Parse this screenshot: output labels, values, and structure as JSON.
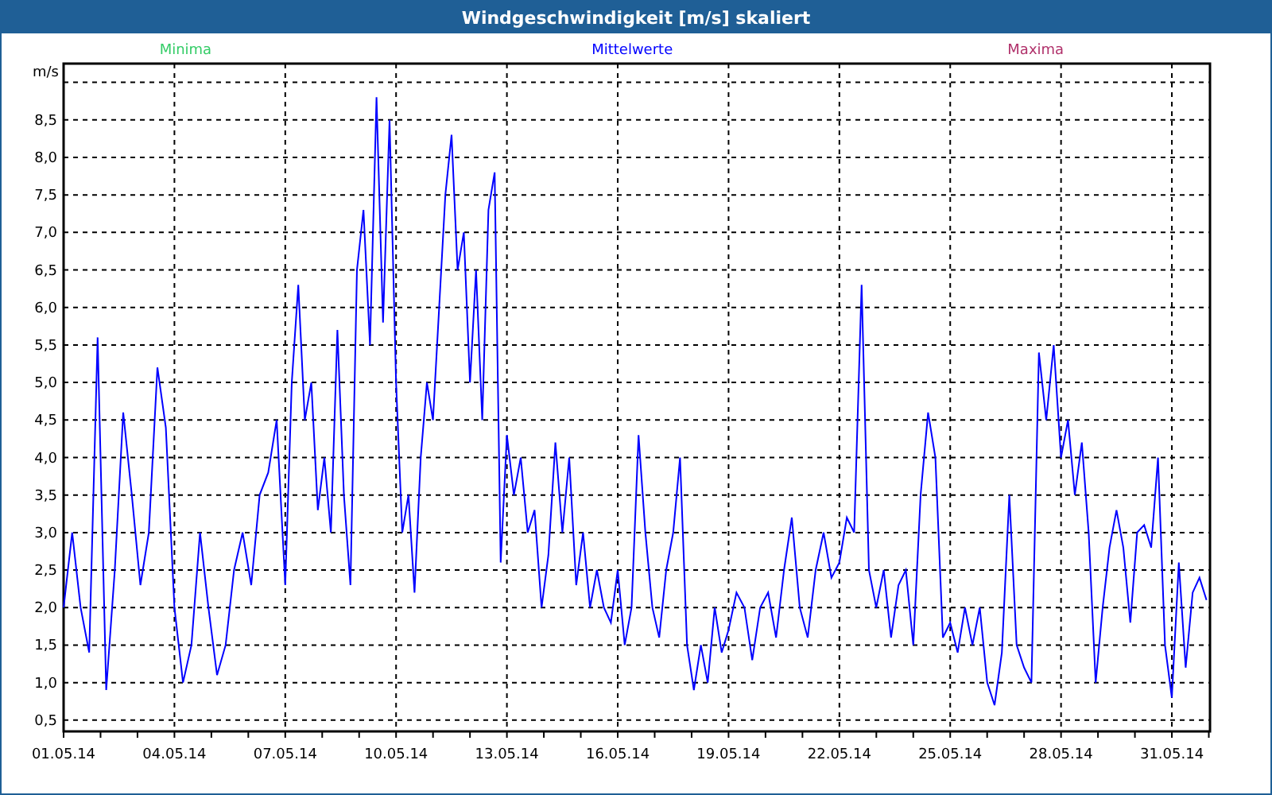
{
  "window": {
    "title": "Windgeschwindigkeit [m/s] skaliert"
  },
  "legend": [
    {
      "label": "Minima",
      "color": "#33cc66"
    },
    {
      "label": "Maxima",
      "color": "#b0306a"
    }
  ],
  "chart": {
    "chart_data": {
      "type": "line",
      "grid": true,
      "ylabel": "m/s",
      "ylim": [
        0.35,
        9.25
      ],
      "yticks": [
        {
          "value": 0.5,
          "label": "0,5"
        },
        {
          "value": 1,
          "label": "1,0"
        },
        {
          "value": 1.5,
          "label": "1,5"
        },
        {
          "value": 2,
          "label": "2,0"
        },
        {
          "value": 2.5,
          "label": "2,5"
        },
        {
          "value": 3,
          "label": "3,0"
        },
        {
          "value": 3.5,
          "label": "3,5"
        },
        {
          "value": 4,
          "label": "4,0"
        },
        {
          "value": 4.5,
          "label": "4,5"
        },
        {
          "value": 5,
          "label": "5,0"
        },
        {
          "value": 5.5,
          "label": "5,5"
        },
        {
          "value": 6,
          "label": "6,0"
        },
        {
          "value": 6.5,
          "label": "6,5"
        },
        {
          "value": 7,
          "label": "7,0"
        },
        {
          "value": 7.5,
          "label": "7,5"
        },
        {
          "value": 8,
          "label": "8,0"
        },
        {
          "value": 8.5,
          "label": "8,5"
        }
      ],
      "categories": [
        "01.05.14",
        null,
        null,
        null,
        null,
        null,
        null,
        null,
        null,
        null,
        null,
        null,
        null,
        "04.05.14",
        null,
        null,
        null,
        null,
        null,
        null,
        null,
        null,
        null,
        null,
        null,
        null,
        "07.05.14",
        null,
        null,
        null,
        null,
        null,
        null,
        null,
        null,
        null,
        null,
        null,
        null,
        null,
        null,
        null,
        null,
        "10.05.14",
        null,
        null,
        null,
        null,
        null,
        null,
        null,
        null,
        null,
        null,
        null,
        null,
        null,
        null,
        null,
        null,
        null,
        "13.05.14",
        null,
        null,
        null,
        null,
        null,
        null,
        null,
        null,
        null,
        null,
        null,
        null,
        null,
        null,
        null,
        "16.05.14",
        null,
        null,
        null,
        null,
        null,
        null,
        null,
        null,
        null,
        null,
        null,
        null,
        null,
        null,
        null,
        "19.05.14",
        null,
        null,
        null,
        null,
        null,
        null,
        null,
        null,
        null,
        null,
        null,
        null,
        null,
        "22.05.14",
        null,
        null,
        null,
        null,
        null,
        null,
        null,
        null,
        null,
        null,
        null,
        null,
        null,
        null,
        "25.05.14",
        null,
        null,
        null,
        null,
        null,
        null,
        null,
        null,
        null,
        null,
        null,
        null,
        null,
        null,
        "28.05.14",
        null,
        null,
        null,
        null,
        null,
        null,
        null,
        null,
        null,
        null,
        null,
        null,
        null,
        null,
        null,
        "31.05.14",
        null,
        null,
        null,
        null,
        null
      ],
      "series": [
        {
          "name": "Mittelwerte",
          "color": "#0000ff",
          "values": [
            2.0,
            3.0,
            2.0,
            1.4,
            5.6,
            0.9,
            2.5,
            4.6,
            3.5,
            2.3,
            3.0,
            5.2,
            4.4,
            2.0,
            1.0,
            1.5,
            3.0,
            2.0,
            1.1,
            1.5,
            2.5,
            3.0,
            2.3,
            3.5,
            3.8,
            4.5,
            2.3,
            5.0,
            6.3,
            4.5,
            5.0,
            3.3,
            4.0,
            3.0,
            5.7,
            3.5,
            2.3,
            6.5,
            7.3,
            5.5,
            8.8,
            5.8,
            8.5,
            5.0,
            3.0,
            3.5,
            2.2,
            4.0,
            5.0,
            4.5,
            6.0,
            7.5,
            8.3,
            6.5,
            7.0,
            5.0,
            6.5,
            4.5,
            7.3,
            7.8,
            2.6,
            4.3,
            3.5,
            4.0,
            3.0,
            3.3,
            2.0,
            2.7,
            4.2,
            3.0,
            4.0,
            2.3,
            3.0,
            2.0,
            2.5,
            2.0,
            1.8,
            2.5,
            1.5,
            2.0,
            4.3,
            3.0,
            2.0,
            1.6,
            2.5,
            3.0,
            4.0,
            1.5,
            0.9,
            1.5,
            1.0,
            2.0,
            1.4,
            1.7,
            2.2,
            2.0,
            1.3,
            2.0,
            2.2,
            1.6,
            2.5,
            3.2,
            2.0,
            1.6,
            2.5,
            3.0,
            2.4,
            2.6,
            3.2,
            3.0,
            6.3,
            2.5,
            2.0,
            2.5,
            1.6,
            2.3,
            2.5,
            1.5,
            3.5,
            4.6,
            4.0,
            1.6,
            1.8,
            1.4,
            2.0,
            1.5,
            2.0,
            1.0,
            0.7,
            1.4,
            3.5,
            1.5,
            1.2,
            1.0,
            5.4,
            4.5,
            5.5,
            4.0,
            4.5,
            3.5,
            4.2,
            3.0,
            1.0,
            2.0,
            2.8,
            3.3,
            2.8,
            1.8,
            3.0,
            3.1,
            2.8,
            4.0,
            1.5,
            0.8,
            2.6,
            1.2,
            2.2,
            2.4,
            2.1
          ]
        }
      ]
    }
  }
}
